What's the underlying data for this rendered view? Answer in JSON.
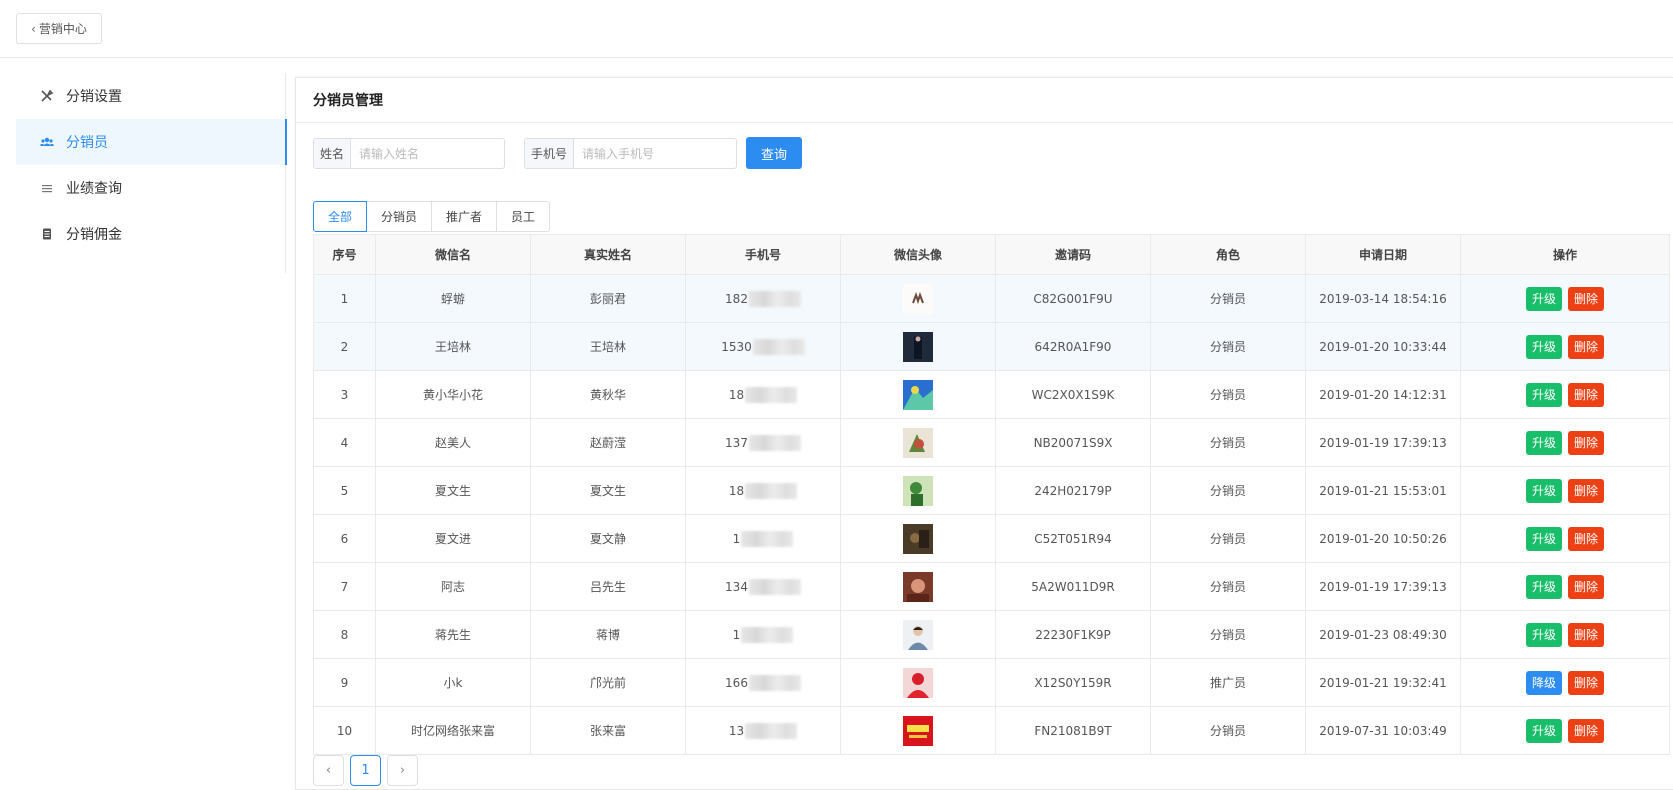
{
  "topbar": {
    "back_label": "营销中心"
  },
  "sidebar": {
    "items": [
      {
        "label": "分销设置",
        "icon": "tools-icon"
      },
      {
        "label": "分销员",
        "icon": "team-icon"
      },
      {
        "label": "业绩查询",
        "icon": "list-icon"
      },
      {
        "label": "分销佣金",
        "icon": "ledger-icon"
      }
    ],
    "active_index": 1
  },
  "panel": {
    "title": "分销员管理"
  },
  "search": {
    "name_label": "姓名",
    "name_placeholder": "请输入姓名",
    "phone_label": "手机号",
    "phone_placeholder": "请输入手机号",
    "query_label": "查询"
  },
  "tabs": [
    {
      "label": "全部"
    },
    {
      "label": "分销员"
    },
    {
      "label": "推广者"
    },
    {
      "label": "员工"
    }
  ],
  "active_tab": 0,
  "table": {
    "columns": [
      "序号",
      "微信名",
      "真实姓名",
      "手机号",
      "微信头像",
      "邀请码",
      "角色",
      "申请日期",
      "操作"
    ],
    "rows": [
      {
        "no": "1",
        "wechat": "蜉蝣",
        "real_name": "彭丽君",
        "phone": "182",
        "code": "C82G001F9U",
        "role": "分销员",
        "date": "2019-03-14 18:54:16",
        "action": "升级",
        "delete": "删除"
      },
      {
        "no": "2",
        "wechat": "王培林",
        "real_name": "王培林",
        "phone": "1530",
        "code": "642R0A1F90",
        "role": "分销员",
        "date": "2019-01-20 10:33:44",
        "action": "升级",
        "delete": "删除"
      },
      {
        "no": "3",
        "wechat": "黄小华小花",
        "real_name": "黄秋华",
        "phone": "18",
        "code": "WC2X0X1S9K",
        "role": "分销员",
        "date": "2019-01-20 14:12:31",
        "action": "升级",
        "delete": "删除"
      },
      {
        "no": "4",
        "wechat": "赵美人",
        "real_name": "赵蔚滢",
        "phone": "137",
        "code": "NB20071S9X",
        "role": "分销员",
        "date": "2019-01-19 17:39:13",
        "action": "升级",
        "delete": "删除"
      },
      {
        "no": "5",
        "wechat": "夏文生",
        "real_name": "夏文生",
        "phone": "18",
        "code": "242H02179P",
        "role": "分销员",
        "date": "2019-01-21 15:53:01",
        "action": "升级",
        "delete": "删除"
      },
      {
        "no": "6",
        "wechat": "夏文进",
        "real_name": "夏文静",
        "phone": "1",
        "code": "C52T051R94",
        "role": "分销员",
        "date": "2019-01-20 10:50:26",
        "action": "升级",
        "delete": "删除"
      },
      {
        "no": "7",
        "wechat": "阿志",
        "real_name": "吕先生",
        "phone": "134",
        "code": "5A2W011D9R",
        "role": "分销员",
        "date": "2019-01-19 17:39:13",
        "action": "升级",
        "delete": "删除"
      },
      {
        "no": "8",
        "wechat": "蒋先生",
        "real_name": "蒋博",
        "phone": "1",
        "code": "22230F1K9P",
        "role": "分销员",
        "date": "2019-01-23 08:49:30",
        "action": "升级",
        "delete": "删除"
      },
      {
        "no": "9",
        "wechat": "小k",
        "real_name": "邝光前",
        "phone": "166",
        "code": "X12S0Y159R",
        "role": "推广员",
        "date": "2019-01-21 19:32:41",
        "action": "降级",
        "delete": "删除"
      },
      {
        "no": "10",
        "wechat": "时亿网络张来富",
        "real_name": "张来富",
        "phone": "13",
        "code": "FN21081B9T",
        "role": "分销员",
        "date": "2019-07-31 10:03:49",
        "action": "升级",
        "delete": "删除"
      }
    ]
  },
  "pagination": {
    "prev": "‹",
    "current": "1",
    "next": "›"
  }
}
